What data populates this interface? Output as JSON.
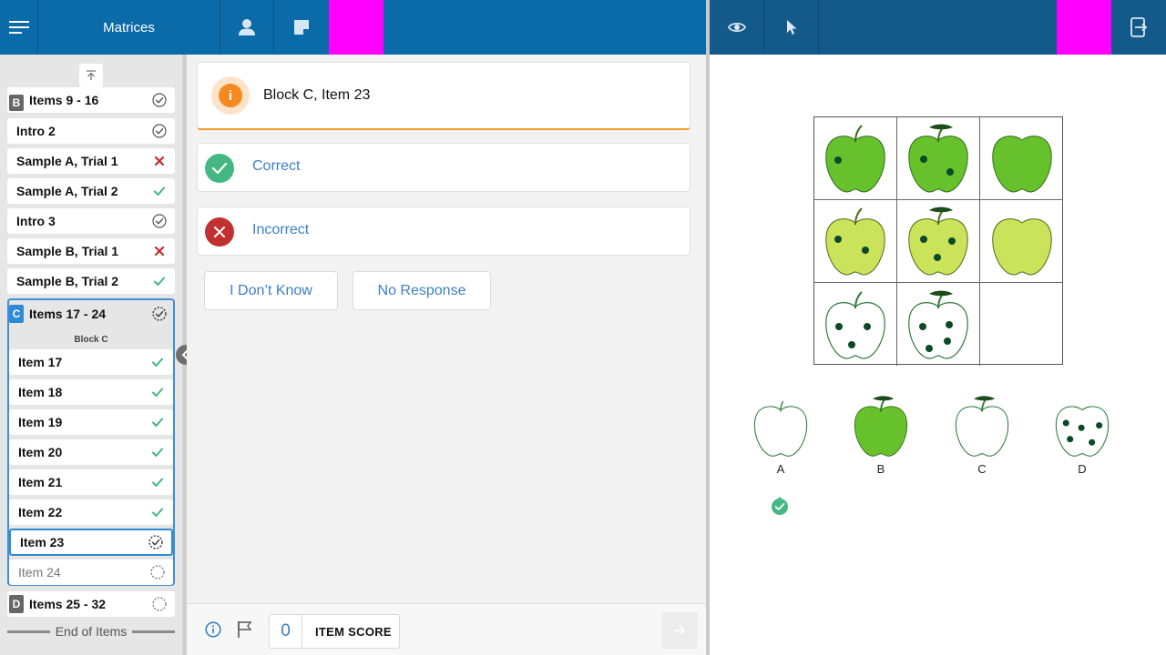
{
  "header": {
    "menu_icon": "hamburger-menu-icon",
    "title": "Matrices",
    "person_icon": "person-icon",
    "notes_icon": "sticky-note-icon",
    "eye_icon": "eye-icon",
    "pointer_icon": "cursor-pointer-icon",
    "exit_icon": "exit-device-icon",
    "magenta_color": "#ff00ff"
  },
  "sidebar": {
    "scroll_top_icon": "scroll-to-top-icon",
    "blockB": {
      "letter": "B",
      "label": "Items 9 - 16",
      "status": "complete"
    },
    "rows": [
      {
        "label": "Intro 2",
        "status": "complete"
      },
      {
        "label": "Sample A, Trial 1",
        "status": "incorrect"
      },
      {
        "label": "Sample A, Trial 2",
        "status": "correct"
      },
      {
        "label": "Intro 3",
        "status": "complete"
      },
      {
        "label": "Sample B, Trial 1",
        "status": "incorrect"
      },
      {
        "label": "Sample B, Trial 2",
        "status": "correct"
      }
    ],
    "blockC": {
      "letter": "C",
      "label": "Items 17 - 24",
      "sublabel": "Block C",
      "status": "in-progress",
      "items": [
        {
          "label": "Item 17",
          "status": "correct"
        },
        {
          "label": "Item 18",
          "status": "correct"
        },
        {
          "label": "Item 19",
          "status": "correct"
        },
        {
          "label": "Item 20",
          "status": "correct"
        },
        {
          "label": "Item 21",
          "status": "correct"
        },
        {
          "label": "Item 22",
          "status": "correct"
        },
        {
          "label": "Item 23",
          "status": "current"
        },
        {
          "label": "Item 24",
          "status": "not-started"
        }
      ]
    },
    "blockD": {
      "letter": "D",
      "label": "Items 25 - 32",
      "status": "not-started"
    },
    "end_label": "End of Items"
  },
  "main": {
    "item_title": "Block C, Item 23",
    "correct_label": "Correct",
    "incorrect_label": "Incorrect",
    "dont_know_label": "I Don’t Know",
    "no_response_label": "No Response"
  },
  "footer": {
    "score_value": "0",
    "score_label": "ITEM SCORE"
  },
  "stimulus": {
    "choices": [
      {
        "label": "A",
        "selected": true
      },
      {
        "label": "B",
        "selected": false
      },
      {
        "label": "C",
        "selected": false
      },
      {
        "label": "D",
        "selected": false
      }
    ]
  },
  "colors": {
    "header_left": "#0b6aa8",
    "header_right": "#135a8a",
    "correct_green": "#43b883",
    "incorrect_red": "#c13131",
    "info_orange": "#f6891f",
    "link_blue": "#3a7fc8",
    "apple_dark_green": "#67c12c",
    "apple_light_green": "#cbe35a"
  }
}
